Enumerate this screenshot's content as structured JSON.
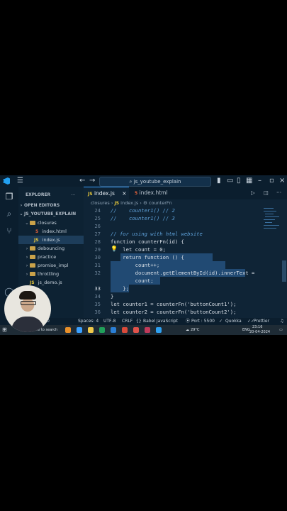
{
  "titlebar": {
    "search": "js_youtube_explain"
  },
  "sidebar": {
    "title": "EXPLORER",
    "open_editors": "OPEN EDITORS",
    "project": "JS_YOUTUBE_EXPLAIN",
    "items": [
      {
        "label": "closures",
        "type": "folder",
        "open": true
      },
      {
        "label": "index.html",
        "type": "html"
      },
      {
        "label": "index.js",
        "type": "js",
        "selected": true
      },
      {
        "label": "debouncing",
        "type": "folder"
      },
      {
        "label": "practice",
        "type": "folder"
      },
      {
        "label": "promise_impl",
        "type": "folder"
      },
      {
        "label": "throttling",
        "type": "folder"
      },
      {
        "label": "js_demo.js",
        "type": "js"
      }
    ]
  },
  "tabs": [
    {
      "label": "index.js",
      "icon": "JS",
      "active": true
    },
    {
      "label": "index.html",
      "icon": "html"
    }
  ],
  "breadcrumb": {
    "folder": "closures",
    "file": "index.js",
    "symbol": "counterFn"
  },
  "editor": {
    "lines": [
      {
        "no": "24",
        "text": "//    counter1() // 2"
      },
      {
        "no": "25",
        "text": "//    counter1() // 3"
      },
      {
        "no": "26",
        "text": ""
      },
      {
        "no": "27",
        "text": "// for using with html website"
      },
      {
        "no": "28",
        "text": "function counterFn(id) {"
      },
      {
        "no": "29",
        "text": "    let count = 0;"
      },
      {
        "no": "30",
        "text": "    return function () {"
      },
      {
        "no": "31",
        "text": "        count++;"
      },
      {
        "no": "32",
        "text": "        document.getElementById(id).innerText ="
      },
      {
        "no": "",
        "text": "        count;"
      },
      {
        "no": "33",
        "text": "    };"
      },
      {
        "no": "34",
        "text": "}"
      },
      {
        "no": "35",
        "text": "let counter1 = counterFn('buttonCount1');"
      },
      {
        "no": "36",
        "text": "let counter2 = counterFn('buttonCount2');"
      }
    ]
  },
  "statusbar": {
    "spaces": "Spaces: 4",
    "encoding": "UTF-8",
    "eol": "CRLF",
    "language": "Babel JavaScript",
    "port": "Port : 5500",
    "quokka": "Quokka",
    "prettier": "Prettier",
    "problems": "0"
  },
  "taskbar": {
    "search": "Type here to search",
    "weather": "29°C",
    "lang": "ENG",
    "time": "23:16",
    "date": "20-04-2024"
  },
  "colors": {
    "accent": "#3aa0ff",
    "background": "#0f2436",
    "selection": "#214a73"
  }
}
